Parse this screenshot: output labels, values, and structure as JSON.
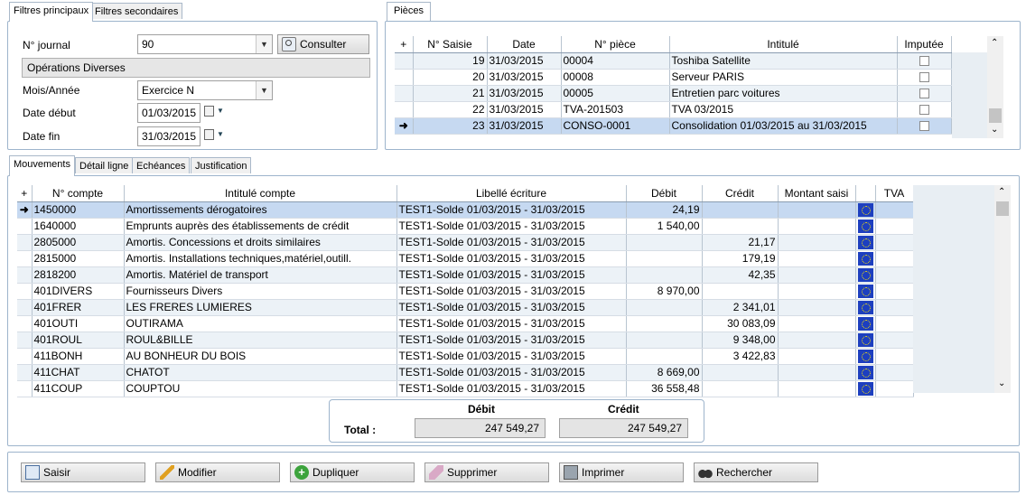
{
  "filters": {
    "tabs": [
      "Filtres principaux",
      "Filtres secondaires"
    ],
    "journal_label": "N° journal",
    "journal_value": "90",
    "consult_label": "Consulter",
    "journal_name": "Opérations Diverses",
    "month_label": "Mois/Année",
    "month_value": "Exercice N",
    "start_label": "Date début",
    "start_value": "01/03/2015",
    "end_label": "Date fin",
    "end_value": "31/03/2015"
  },
  "pieces": {
    "tab": "Pièces",
    "columns": [
      "N° Saisie",
      "Date",
      "N° pièce",
      "Intitulé",
      "Imputée"
    ],
    "rows": [
      {
        "saisie": "19",
        "date": "31/03/2015",
        "piece": "00004",
        "intitule": "Toshiba Satellite"
      },
      {
        "saisie": "20",
        "date": "31/03/2015",
        "piece": "00008",
        "intitule": "Serveur PARIS"
      },
      {
        "saisie": "21",
        "date": "31/03/2015",
        "piece": "00005",
        "intitule": "Entretien parc voitures"
      },
      {
        "saisie": "22",
        "date": "31/03/2015",
        "piece": "TVA-201503",
        "intitule": "TVA 03/2015"
      },
      {
        "saisie": "23",
        "date": "31/03/2015",
        "piece": "CONSO-0001",
        "intitule": "Consolidation 01/03/2015 au 31/03/2015"
      }
    ]
  },
  "movements": {
    "tabs": [
      "Mouvements",
      "Détail ligne",
      "Echéances",
      "Justification"
    ],
    "columns": [
      "N° compte",
      "Intitulé compte",
      "Libellé écriture",
      "Débit",
      "Crédit",
      "Montant saisi",
      "TVA"
    ],
    "rows": [
      {
        "compte": "1450000",
        "intitule": "Amortissements dérogatoires",
        "libelle": "TEST1-Solde 01/03/2015 - 31/03/2015",
        "debit": "24,19",
        "credit": ""
      },
      {
        "compte": "1640000",
        "intitule": "Emprunts auprès des établissements de crédit",
        "libelle": "TEST1-Solde 01/03/2015 - 31/03/2015",
        "debit": "1 540,00",
        "credit": ""
      },
      {
        "compte": "2805000",
        "intitule": "Amortis. Concessions et droits similaires",
        "libelle": "TEST1-Solde 01/03/2015 - 31/03/2015",
        "debit": "",
        "credit": "21,17"
      },
      {
        "compte": "2815000",
        "intitule": "Amortis. Installations techniques,matériel,outill.",
        "libelle": "TEST1-Solde 01/03/2015 - 31/03/2015",
        "debit": "",
        "credit": "179,19"
      },
      {
        "compte": "2818200",
        "intitule": "Amortis. Matériel de transport",
        "libelle": "TEST1-Solde 01/03/2015 - 31/03/2015",
        "debit": "",
        "credit": "42,35"
      },
      {
        "compte": "401DIVERS",
        "intitule": "Fournisseurs Divers",
        "libelle": "TEST1-Solde 01/03/2015 - 31/03/2015",
        "debit": "8 970,00",
        "credit": ""
      },
      {
        "compte": "401FRER",
        "intitule": "LES FRERES LUMIERES",
        "libelle": "TEST1-Solde 01/03/2015 - 31/03/2015",
        "debit": "",
        "credit": "2 341,01"
      },
      {
        "compte": "401OUTI",
        "intitule": "OUTIRAMA",
        "libelle": "TEST1-Solde 01/03/2015 - 31/03/2015",
        "debit": "",
        "credit": "30 083,09"
      },
      {
        "compte": "401ROUL",
        "intitule": "ROUL&BILLE",
        "libelle": "TEST1-Solde 01/03/2015 - 31/03/2015",
        "debit": "",
        "credit": "9 348,00"
      },
      {
        "compte": "411BONH",
        "intitule": "AU BONHEUR DU BOIS",
        "libelle": "TEST1-Solde 01/03/2015 - 31/03/2015",
        "debit": "",
        "credit": "3 422,83"
      },
      {
        "compte": "411CHAT",
        "intitule": "CHATOT",
        "libelle": "TEST1-Solde 01/03/2015 - 31/03/2015",
        "debit": "8 669,00",
        "credit": ""
      },
      {
        "compte": "411COUP",
        "intitule": "COUPTOU",
        "libelle": "TEST1-Solde 01/03/2015 - 31/03/2015",
        "debit": "36 558,48",
        "credit": ""
      }
    ]
  },
  "totals": {
    "debit_label": "Débit",
    "credit_label": "Crédit",
    "total_label": "Total :",
    "debit_value": "247 549,27",
    "credit_value": "247 549,27"
  },
  "actions": {
    "saisir": "Saisir",
    "modifier": "Modifier",
    "dupliquer": "Dupliquer",
    "supprimer": "Supprimer",
    "imprimer": "Imprimer",
    "rechercher": "Rechercher"
  }
}
